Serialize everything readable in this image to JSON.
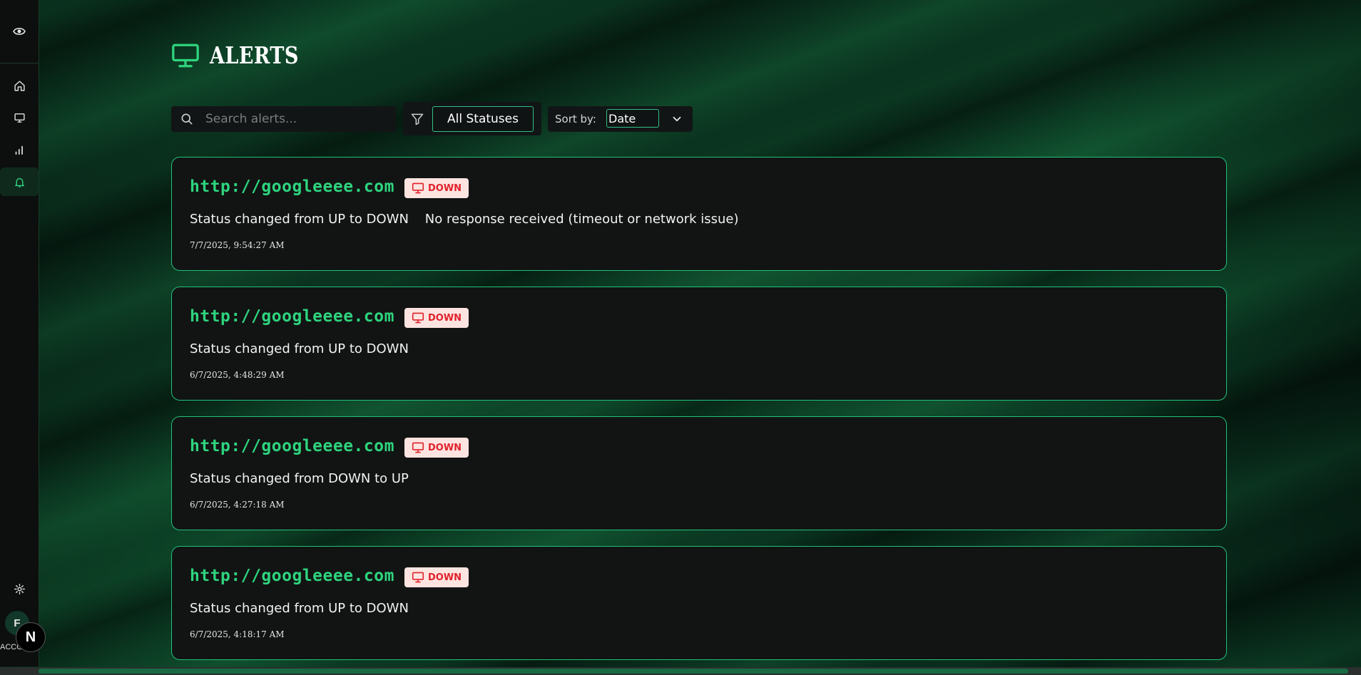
{
  "page": {
    "title": "ALERTS"
  },
  "sidebar": {
    "items": [
      {
        "name": "home"
      },
      {
        "name": "monitors"
      },
      {
        "name": "analytics"
      },
      {
        "name": "alerts",
        "active": true
      }
    ],
    "avatar_letter": "F",
    "account_label": "ACCOUNT",
    "next_badge": "N"
  },
  "search": {
    "placeholder": "Search alerts...",
    "value": ""
  },
  "filter": {
    "selected": "All Statuses"
  },
  "sort": {
    "label": "Sort by:",
    "selected": "Date"
  },
  "alerts": [
    {
      "url": "http://googleeee.com",
      "status": "DOWN",
      "message": "Status changed from UP to DOWN    No response received (timeout or network issue)",
      "time": "7/7/2025, 9:54:27 AM"
    },
    {
      "url": "http://googleeee.com",
      "status": "DOWN",
      "message": "Status changed from UP to DOWN",
      "time": "6/7/2025, 4:48:29 AM"
    },
    {
      "url": "http://googleeee.com",
      "status": "DOWN",
      "message": "Status changed from DOWN to UP",
      "time": "6/7/2025, 4:27:18 AM"
    },
    {
      "url": "http://googleeee.com",
      "status": "DOWN",
      "message": "Status changed from UP to DOWN",
      "time": "6/7/2025, 4:18:17 AM"
    }
  ],
  "colors": {
    "accent": "#2ed47e",
    "badge_bg": "#fde4e1",
    "badge_text": "#e0222b",
    "card_bg": "#121413"
  }
}
